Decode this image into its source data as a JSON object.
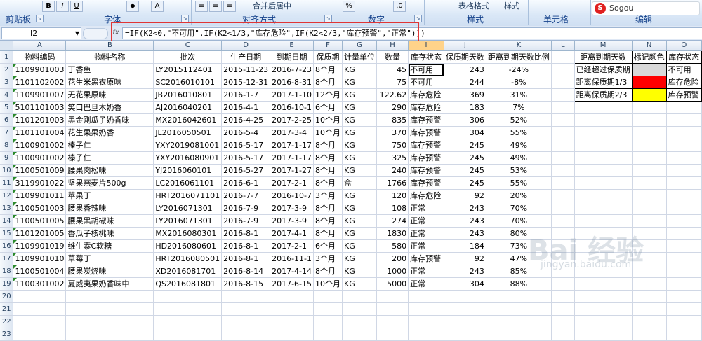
{
  "ribbon": {
    "groups": [
      "剪贴板",
      "字体",
      "对齐方式",
      "数字",
      "样式",
      "单元格",
      "编辑"
    ],
    "buttons": {
      "merge": "合并后居中",
      "table_format": "表格格式",
      "cell_style": "样式"
    },
    "logo_text": "Sogou"
  },
  "formula_bar": {
    "name_box": "I2",
    "fx": "fx",
    "formula": "=IF(K2<0,\"不可用\",IF(K2<1/3,\"库存危险\",IF(K2<2/3,\"库存预警\",\"正常\")))"
  },
  "columns": [
    "A",
    "B",
    "C",
    "D",
    "E",
    "F",
    "G",
    "H",
    "I",
    "J",
    "K",
    "L",
    "M",
    "N",
    "O"
  ],
  "headers": [
    "物料编码",
    "物料名称",
    "批次",
    "生产日期",
    "到期日期",
    "保质期",
    "计量单位",
    "数量",
    "库存状态",
    "保质期天数",
    "距离到期天数比例"
  ],
  "rows": [
    [
      "1109901003",
      "丁香鱼",
      "LY2015112401",
      "2015-11-23",
      "2016-7-23",
      "8个月",
      "KG",
      "45",
      "不可用",
      "243",
      "-24%"
    ],
    [
      "1101102002",
      "花生米黑衣原味",
      "SC2016010101",
      "2015-12-31",
      "2016-8-31",
      "8个月",
      "KG",
      "75",
      "不可用",
      "244",
      "-8%"
    ],
    [
      "1109901007",
      "无花果原味",
      "JB2016010801",
      "2016-1-7",
      "2017-1-10",
      "12个月",
      "KG",
      "122.62",
      "库存危险",
      "369",
      "31%"
    ],
    [
      "5101101003",
      "笑口巴旦木奶香",
      "AJ2016040201",
      "2016-4-1",
      "2016-10-1",
      "6个月",
      "KG",
      "290",
      "库存危险",
      "183",
      "7%"
    ],
    [
      "1101201003",
      "黑金刚瓜子奶香味",
      "MX2016042601",
      "2016-4-25",
      "2017-2-25",
      "10个月",
      "KG",
      "835",
      "库存预警",
      "306",
      "52%"
    ],
    [
      "1101101004",
      "花生果果奶香",
      "JL2016050501",
      "2016-5-4",
      "2017-3-4",
      "10个月",
      "KG",
      "370",
      "库存预警",
      "304",
      "55%"
    ],
    [
      "1100901002",
      "榛子仁",
      "YXY2019081001",
      "2016-5-17",
      "2017-1-17",
      "8个月",
      "KG",
      "750",
      "库存预警",
      "245",
      "49%"
    ],
    [
      "1100901002",
      "榛子仁",
      "YXY2016080901",
      "2016-5-17",
      "2017-1-17",
      "8个月",
      "KG",
      "325",
      "库存预警",
      "245",
      "49%"
    ],
    [
      "1100501009",
      "腰果肉松味",
      "YJ2016060101",
      "2016-5-27",
      "2017-1-27",
      "8个月",
      "KG",
      "240",
      "库存预警",
      "245",
      "53%"
    ],
    [
      "3119901022",
      "坚果燕麦片500g",
      "LC2016061101",
      "2016-6-1",
      "2017-2-1",
      "8个月",
      "盒",
      "1766",
      "库存预警",
      "245",
      "55%"
    ],
    [
      "1109901011",
      "苹果丁",
      "HRT2016071101",
      "2016-7-7",
      "2016-10-7",
      "3个月",
      "KG",
      "120",
      "库存危险",
      "92",
      "20%"
    ],
    [
      "1100501003",
      "腰果香辣味",
      "LY2016071301",
      "2016-7-9",
      "2017-3-9",
      "8个月",
      "KG",
      "108",
      "正常",
      "243",
      "70%"
    ],
    [
      "1100501005",
      "腰果黑胡椒味",
      "LY2016071301",
      "2016-7-9",
      "2017-3-9",
      "8个月",
      "KG",
      "274",
      "正常",
      "243",
      "70%"
    ],
    [
      "1101201005",
      "香瓜子核桃味",
      "MX2016080301",
      "2016-8-1",
      "2017-4-1",
      "8个月",
      "KG",
      "1830",
      "正常",
      "243",
      "80%"
    ],
    [
      "1109901019",
      "维生素C软糖",
      "HD2016080601",
      "2016-8-1",
      "2017-2-1",
      "6个月",
      "KG",
      "580",
      "正常",
      "184",
      "73%"
    ],
    [
      "1109901010",
      "草莓丁",
      "HRT2016080501",
      "2016-8-1",
      "2016-11-1",
      "3个月",
      "KG",
      "200",
      "库存预警",
      "92",
      "47%"
    ],
    [
      "1100501004",
      "腰果炭烧味",
      "XD2016081701",
      "2016-8-14",
      "2017-4-14",
      "8个月",
      "KG",
      "1000",
      "正常",
      "243",
      "85%"
    ],
    [
      "1100301002",
      "夏威夷果奶香味中",
      "QS2016081801",
      "2016-8-15",
      "2017-6-15",
      "10个月",
      "KG",
      "5000",
      "正常",
      "304",
      "88%"
    ]
  ],
  "legend": {
    "headers": [
      "距离到期天数",
      "标记颜色",
      "库存状态"
    ],
    "rows": [
      {
        "label": "已经超过保质期",
        "color": "#d9d9d9",
        "status": "不可用"
      },
      {
        "label": "距离保质期1/3",
        "color": "#ff0000",
        "status": "库存危险"
      },
      {
        "label": "距离保质期2/3",
        "color": "#ffff00",
        "status": "库存预警"
      }
    ]
  },
  "row_numbers": [
    "1",
    "2",
    "3",
    "4",
    "5",
    "6",
    "7",
    "8",
    "9",
    "10",
    "11",
    "12",
    "13",
    "14",
    "15",
    "16",
    "17",
    "18",
    "19",
    "20",
    "21",
    "22",
    "23"
  ],
  "watermark": "Bai 经验",
  "watermark_sub": "jingyan.baidu.com"
}
